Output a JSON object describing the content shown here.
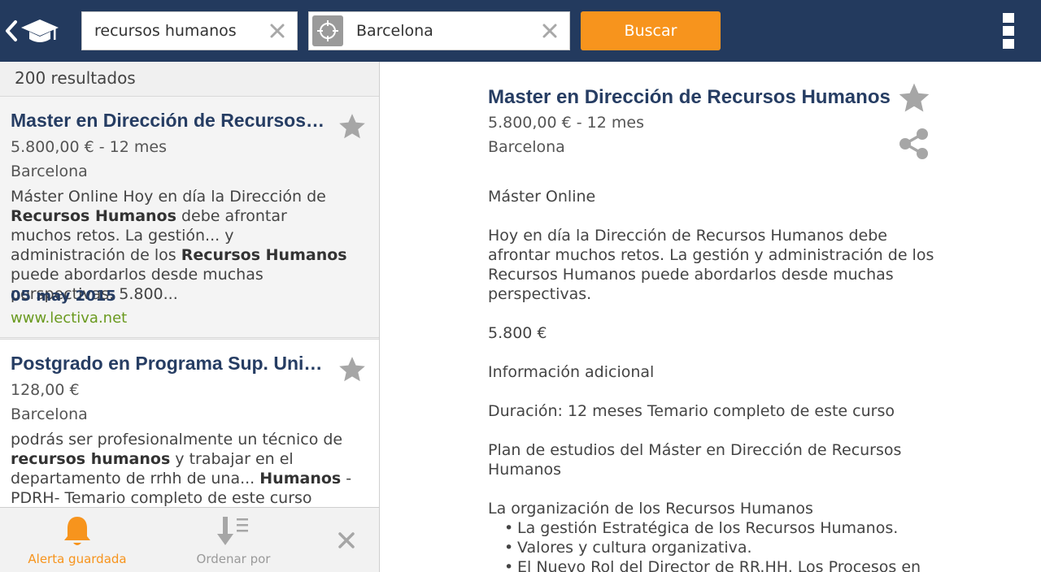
{
  "search": {
    "what_value": "recursos humanos",
    "where_value": "Barcelona",
    "button_label": "Buscar"
  },
  "results": {
    "count_label": "200 resultados",
    "cards": [
      {
        "title": "Master en Dirección de Recursos Humanos",
        "price": "5.800,00 € - 12 mes",
        "city": "Barcelona",
        "desc_1": "Máster Online Hoy en día la Dirección de ",
        "desc_b1": "Recursos Humanos",
        "desc_2": " debe afrontar muchos retos. La gestión... y administración de los ",
        "desc_b2": "Recursos Humanos",
        "desc_3": " puede abordarlos desde muchas perspectivas. 5.800...",
        "date": "05 may 2015",
        "site": "www.lectiva.net"
      },
      {
        "title": "Postgrado en Programa Sup. Universitario",
        "price": "128,00 €",
        "city": "Barcelona",
        "desc_1": "podrás ser profesionalmente un técnico de ",
        "desc_b1": "recursos humanos",
        "desc_2": " y trabajar en el departamento de rrhh de una... ",
        "desc_b2": "Humanos",
        "desc_3": " - PDRH- Temario completo de este curso"
      }
    ]
  },
  "bottom_bar": {
    "alert_label": "Alerta guardada",
    "sort_label": "Ordenar por"
  },
  "detail": {
    "title": "Master en Dirección de Recursos Humanos",
    "price": "5.800,00 € - 12 mes",
    "city": "Barcelona",
    "p1": "Máster Online",
    "p2": "Hoy en día la Dirección de Recursos Humanos debe afrontar muchos retos. La gestión y administración de los Recursos Humanos puede abordarlos desde muchas perspectivas.",
    "p3": "5.800 €",
    "p4": "Información adicional",
    "p5": "Duración: 12 meses Temario completo de este curso",
    "p6": "Plan de estudios del Máster en Dirección de Recursos Humanos",
    "p7": "La organización de los Recursos Humanos",
    "bullets": [
      "La gestión Estratégica de los Recursos Humanos.",
      "Valores y cultura organizativa.",
      "El Nuevo Rol del Director de RR.HH. Los Procesos en"
    ]
  },
  "colors": {
    "header_bg": "#233a5e",
    "accent_orange": "#f7941d",
    "title_blue": "#263d63",
    "link_green": "#6a9a1f",
    "icon_grey": "#9a9a9a"
  },
  "icons": {
    "back": "chevron-left-icon",
    "logo": "graduation-cap-icon",
    "clear": "close-icon",
    "locate": "crosshair-icon",
    "menu": "overflow-menu-icon",
    "favorite": "star-icon",
    "share": "share-icon",
    "alert": "bell-icon",
    "sort": "sort-down-icon"
  }
}
